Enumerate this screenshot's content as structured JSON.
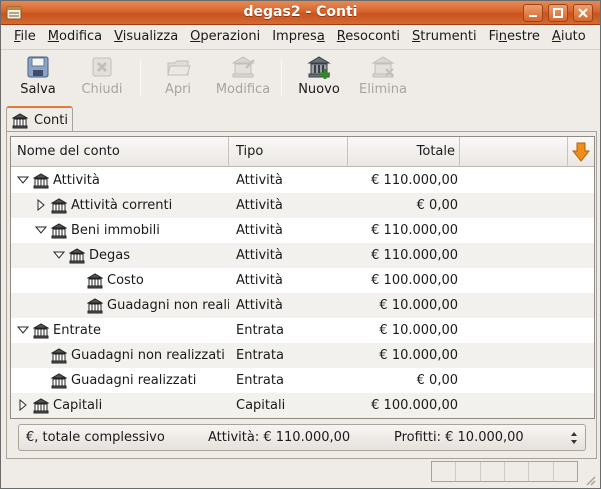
{
  "window": {
    "title": "degas2 - Conti"
  },
  "menubar": [
    {
      "pre": "",
      "u": "F",
      "post": "ile"
    },
    {
      "pre": "",
      "u": "M",
      "post": "odifica"
    },
    {
      "pre": "",
      "u": "V",
      "post": "isualizza"
    },
    {
      "pre": "",
      "u": "O",
      "post": "perazioni"
    },
    {
      "pre": "Impres",
      "u": "a",
      "post": ""
    },
    {
      "pre": "",
      "u": "R",
      "post": "esoconti"
    },
    {
      "pre": "",
      "u": "S",
      "post": "trumenti"
    },
    {
      "pre": "Fi",
      "u": "n",
      "post": "estre"
    },
    {
      "pre": "",
      "u": "A",
      "post": "iuto"
    }
  ],
  "toolbar": {
    "save": "Salva",
    "close": "Chiudi",
    "open": "Apri",
    "edit": "Modifica",
    "new": "Nuovo",
    "delete": "Elimina"
  },
  "tab": {
    "label": "Conti"
  },
  "tree": {
    "columns": {
      "name": "Nome del conto",
      "type": "Tipo",
      "total": "Totale"
    },
    "rows": [
      {
        "name": "Attività",
        "type": "Attività",
        "total": "€ 110.000,00",
        "level": 0,
        "expander": "open"
      },
      {
        "name": "Attività correnti",
        "type": "Attività",
        "total": "€ 0,00",
        "level": 1,
        "expander": "closed"
      },
      {
        "name": "Beni immobili",
        "type": "Attività",
        "total": "€ 110.000,00",
        "level": 1,
        "expander": "open"
      },
      {
        "name": "Degas",
        "type": "Attività",
        "total": "€ 110.000,00",
        "level": 2,
        "expander": "open"
      },
      {
        "name": "Costo",
        "type": "Attività",
        "total": "€ 100.000,00",
        "level": 3,
        "expander": "none"
      },
      {
        "name": "Guadagni non realizzati",
        "type": "Attività",
        "total": "€ 10.000,00",
        "level": 3,
        "expander": "none"
      },
      {
        "name": "Entrate",
        "type": "Entrata",
        "total": "€ 10.000,00",
        "level": 0,
        "expander": "open"
      },
      {
        "name": "Guadagni non realizzati",
        "type": "Entrata",
        "total": "€ 10.000,00",
        "level": 1,
        "expander": "none"
      },
      {
        "name": "Guadagni realizzati",
        "type": "Entrata",
        "total": "€ 0,00",
        "level": 1,
        "expander": "none"
      },
      {
        "name": "Capitali",
        "type": "Capitali",
        "total": "€ 100.000,00",
        "level": 0,
        "expander": "closed"
      }
    ]
  },
  "summary": {
    "label": "€, totale complessivo",
    "assets": "Attività: € 110.000,00",
    "profits": "Profitti: € 10.000,00"
  },
  "icons": {
    "app": "gnucash-app-icon",
    "row": "bank-account-icon",
    "column_selector": "down-arrow-icon"
  },
  "colors": {
    "title_accent": "#d8642d",
    "selector_arrow": "#f08c1a"
  }
}
